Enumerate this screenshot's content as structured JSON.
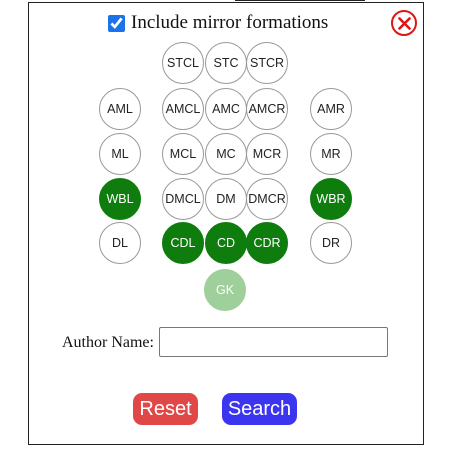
{
  "options": {
    "mirror_label": "Include mirror formations",
    "mirror_checked": true
  },
  "positions": {
    "STCL": {
      "label": "STCL",
      "selected": false
    },
    "STC": {
      "label": "STC",
      "selected": false
    },
    "STCR": {
      "label": "STCR",
      "selected": false
    },
    "AML": {
      "label": "AML",
      "selected": false
    },
    "AMCL": {
      "label": "AMCL",
      "selected": false
    },
    "AMC": {
      "label": "AMC",
      "selected": false
    },
    "AMCR": {
      "label": "AMCR",
      "selected": false
    },
    "AMR": {
      "label": "AMR",
      "selected": false
    },
    "ML": {
      "label": "ML",
      "selected": false
    },
    "MCL": {
      "label": "MCL",
      "selected": false
    },
    "MC": {
      "label": "MC",
      "selected": false
    },
    "MCR": {
      "label": "MCR",
      "selected": false
    },
    "MR": {
      "label": "MR",
      "selected": false
    },
    "WBL": {
      "label": "WBL",
      "selected": true
    },
    "DMCL": {
      "label": "DMCL",
      "selected": false
    },
    "DM": {
      "label": "DM",
      "selected": false
    },
    "DMCR": {
      "label": "DMCR",
      "selected": false
    },
    "WBR": {
      "label": "WBR",
      "selected": true
    },
    "DL": {
      "label": "DL",
      "selected": false
    },
    "CDL": {
      "label": "CDL",
      "selected": true
    },
    "CD": {
      "label": "CD",
      "selected": true
    },
    "CDR": {
      "label": "CDR",
      "selected": true
    },
    "DR": {
      "label": "DR",
      "selected": false
    },
    "GK": {
      "label": "GK",
      "selected": true
    }
  },
  "author": {
    "label": "Author Name:",
    "value": "",
    "placeholder": ""
  },
  "buttons": {
    "reset": "Reset",
    "search": "Search"
  },
  "colors": {
    "selected": "#0e7d0e",
    "goalkeeper": "#9fcf9a",
    "reset": "#e04848",
    "search": "#3c35f0",
    "close": "#e01515"
  }
}
